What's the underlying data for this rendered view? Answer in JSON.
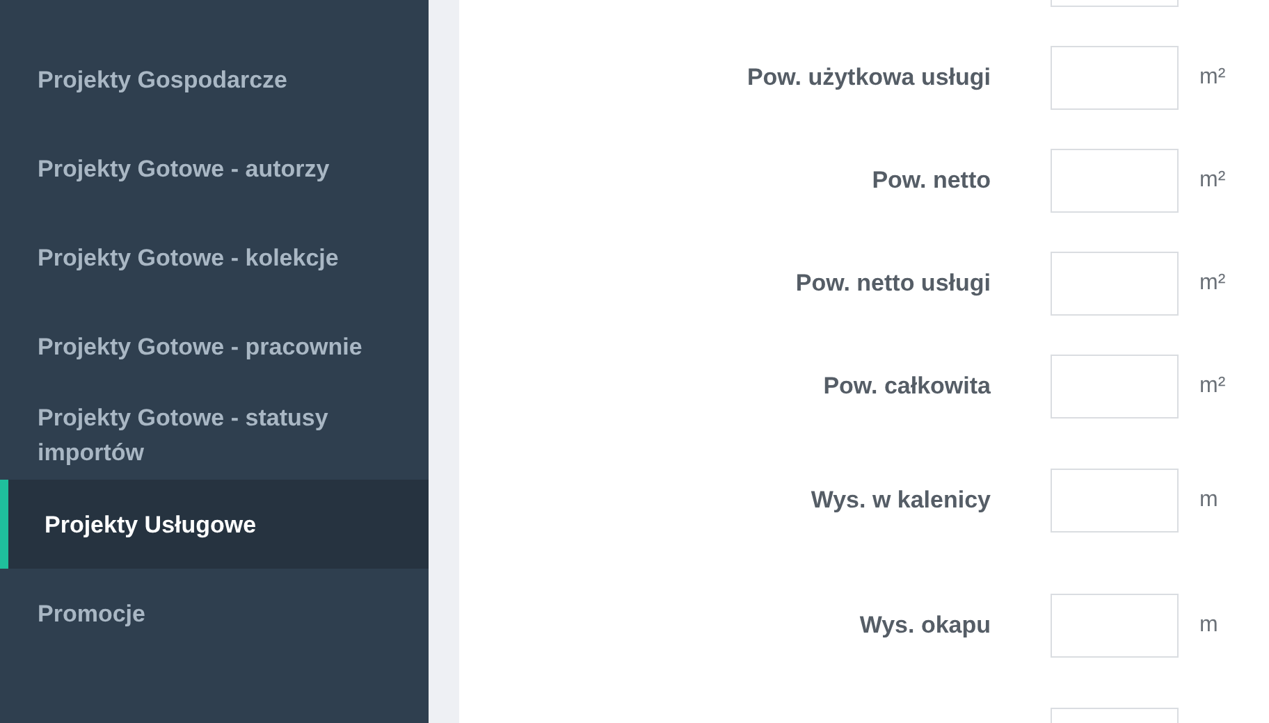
{
  "sidebar": {
    "items": [
      {
        "label": "Projekty Gospodarcze",
        "selected": false
      },
      {
        "label": "Projekty Gotowe - autorzy",
        "selected": false
      },
      {
        "label": "Projekty Gotowe - kolekcje",
        "selected": false
      },
      {
        "label": "Projekty Gotowe - pracownie",
        "selected": false
      },
      {
        "label": "Projekty Gotowe - statusy importów",
        "selected": false
      },
      {
        "label": "Projekty Usługowe",
        "selected": true
      },
      {
        "label": "Promocje",
        "selected": false
      }
    ]
  },
  "form": {
    "fields": [
      {
        "kind": "clipped"
      },
      {
        "kind": "area",
        "label": "Pow. użytkowa usługi",
        "unit": "m²"
      },
      {
        "kind": "area",
        "label": "Pow. netto",
        "unit": "m²"
      },
      {
        "kind": "area",
        "label": "Pow. netto usługi",
        "unit": "m²"
      },
      {
        "kind": "area",
        "label": "Pow. całkowita",
        "unit": "m²"
      },
      {
        "kind": "length",
        "label": "Wys. w kalenicy",
        "unit": "m"
      },
      {
        "kind": "length",
        "label": "Wys. okapu",
        "unit": "m"
      },
      {
        "kind": "clipped"
      }
    ]
  }
}
